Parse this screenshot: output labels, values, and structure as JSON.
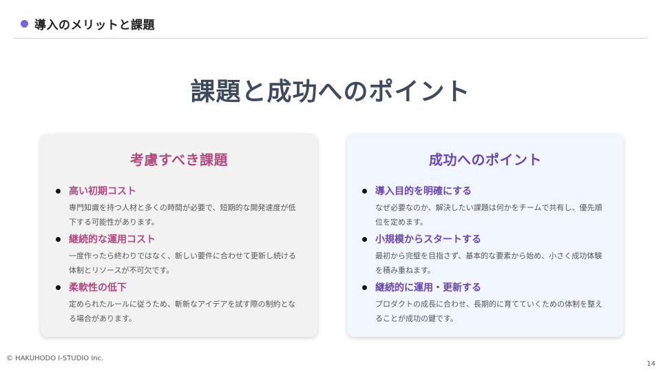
{
  "header": {
    "section_title": "導入のメリットと課題"
  },
  "main": {
    "title": "課題と成功へのポイント"
  },
  "cards": {
    "left": {
      "title": "考慮すべき課題",
      "items": [
        {
          "title": "高い初期コスト",
          "desc": "専門知識を持つ人材と多くの時間が必要で、短期的な開発速度が低下する可能性があります。"
        },
        {
          "title": "継続的な運用コスト",
          "desc": "一度作ったら終わりではなく、新しい要件に合わせて更新し続ける体制とリソースが不可欠です。"
        },
        {
          "title": "柔軟性の低下",
          "desc": "定められたルールに従うため、斬新なアイデアを試す際の制約となる場合があります。"
        }
      ]
    },
    "right": {
      "title": "成功へのポイント",
      "items": [
        {
          "title": "導入目的を明確にする",
          "desc": "なぜ必要なのか、解決したい課題は何かをチームで共有し、優先順位を定めます。"
        },
        {
          "title": "小規模からスタートする",
          "desc": "最初から完璧を目指さず、基本的な要素から始め、小さく成功体験を積み重ねます。"
        },
        {
          "title": "継続的に運用・更新する",
          "desc": "プロダクトの成長に合わせ、長期的に育てていくための体制を整えることが成功の鍵です。"
        }
      ]
    }
  },
  "footer": {
    "copyright": "© HAKUHODO I-STUDIO Inc.",
    "page_number": "14"
  }
}
